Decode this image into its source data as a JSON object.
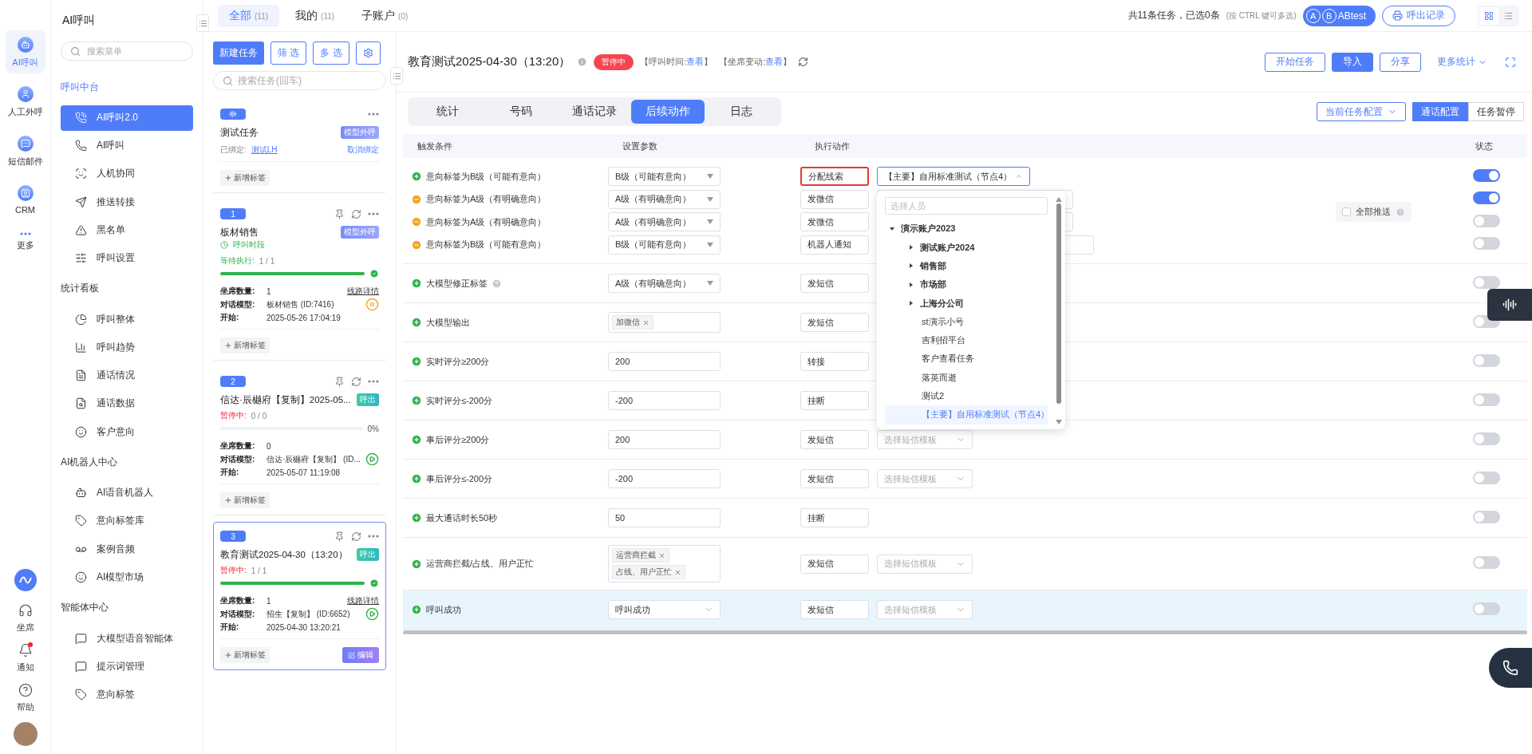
{
  "rail": {
    "items": [
      {
        "label": "AI呼叫",
        "kind": "bot",
        "selected": true
      },
      {
        "label": "人工外呼",
        "kind": "person",
        "selected": false
      },
      {
        "label": "短信邮件",
        "kind": "message",
        "selected": false
      },
      {
        "label": "CRM",
        "kind": "crm",
        "selected": false
      },
      {
        "label": "更多",
        "kind": "more",
        "selected": false
      }
    ],
    "bottom": [
      {
        "label": "坐席",
        "kind": "headset",
        "alert": false
      },
      {
        "label": "通知",
        "kind": "bell",
        "alert": true
      },
      {
        "label": "帮助",
        "kind": "help",
        "alert": false
      }
    ]
  },
  "menu": {
    "title": "AI呼叫",
    "search_placeholder": "搜索菜单",
    "sections": [
      {
        "title": "呼叫中台",
        "selected": true,
        "items": [
          {
            "label": "AI呼叫2.0",
            "kind": "phone-call",
            "selected": true
          },
          {
            "label": "AI呼叫",
            "kind": "phone",
            "selected": false
          },
          {
            "label": "人机协同",
            "kind": "scan",
            "selected": false
          },
          {
            "label": "推送转接",
            "kind": "send",
            "selected": false
          },
          {
            "label": "黑名单",
            "kind": "alert",
            "selected": false
          },
          {
            "label": "呼叫设置",
            "kind": "sliders",
            "selected": false
          }
        ]
      },
      {
        "title": "统计看板",
        "selected": false,
        "items": [
          {
            "label": "呼叫整体",
            "kind": "pie",
            "selected": false
          },
          {
            "label": "呼叫趋势",
            "kind": "bars",
            "selected": false
          },
          {
            "label": "通话情况",
            "kind": "doc",
            "selected": false
          },
          {
            "label": "通话数据",
            "kind": "doc-search",
            "selected": false
          },
          {
            "label": "客户意向",
            "kind": "smile",
            "selected": false
          }
        ]
      },
      {
        "title": "AI机器人中心",
        "selected": false,
        "items": [
          {
            "label": "AI语音机器人",
            "kind": "bot",
            "selected": false
          },
          {
            "label": "意向标签库",
            "kind": "tag",
            "selected": false
          },
          {
            "label": "案例音频",
            "kind": "voicemail",
            "selected": false
          },
          {
            "label": "AI模型市场",
            "kind": "smile",
            "selected": false
          }
        ]
      },
      {
        "title": "智能体中心",
        "selected": false,
        "items": [
          {
            "label": "大模型语音智能体",
            "kind": "chat",
            "selected": false
          },
          {
            "label": "提示词管理",
            "kind": "chat",
            "selected": false
          },
          {
            "label": "意向标签",
            "kind": "tag",
            "selected": false
          }
        ]
      }
    ]
  },
  "top": {
    "tabs": [
      {
        "label": "全部",
        "count": "(11)",
        "selected": true
      },
      {
        "label": "我的",
        "count": "(11)",
        "selected": false
      },
      {
        "label": "子账户",
        "count": "(0)",
        "selected": false
      }
    ],
    "summary": "共11条任务，已选0条",
    "hint": "(按 CTRL 键可多选)",
    "abtest": {
      "letters": [
        "A",
        "B"
      ],
      "label": "ABtest"
    },
    "records": "呼出记录",
    "views": [
      {
        "kind": "grid",
        "selected": true
      },
      {
        "kind": "list",
        "selected": false
      }
    ]
  },
  "task_list": {
    "new": "新建任务",
    "filter": "筛 选",
    "multi": "多 选",
    "search_placeholder": "搜索任务(回车)",
    "cards": [
      {
        "kind": "bound",
        "title": "测试任务",
        "tag": {
          "label": "模型外呼",
          "kind": "model"
        },
        "bound_label": "已绑定:",
        "bound_link": "测试LH",
        "unbind": "取消绑定",
        "add_tag": "新增标签",
        "selected": false
      },
      {
        "kind": "task",
        "number": "1",
        "title": "板材销售",
        "tag": {
          "label": "模型外呼",
          "kind": "model"
        },
        "schedule": "呼叫时段",
        "status": {
          "label": "等待执行:",
          "value": "1 / 1",
          "kind": "waiting"
        },
        "level": 1,
        "done": true,
        "seats_label": "坐席数量:",
        "seats": "1",
        "line_link": "线路详情",
        "model_label": "对话模型:",
        "model": "板材销售 (ID:7416)",
        "control": {
          "kind": "pause"
        },
        "start_label": "开始:",
        "start": "2025-05-26 17:04:19",
        "add_tag": "新增标签",
        "selected": false
      },
      {
        "kind": "task",
        "number": "2",
        "title": "信达·辰樾府【复制】2025-05...",
        "tag": {
          "label": "呼出",
          "kind": "call"
        },
        "status": {
          "label": "暂停中:",
          "value": "0 / 0",
          "kind": "paused"
        },
        "level": 0,
        "done": false,
        "percent": "0%",
        "seats_label": "坐席数量:",
        "seats": "0",
        "model_label": "对话模型:",
        "model": "信达·辰樾府【复制】 (ID...",
        "control": {
          "kind": "play"
        },
        "start_label": "开始:",
        "start": "2025-05-07 11:19:08",
        "add_tag": "新增标签",
        "selected": false
      },
      {
        "kind": "task",
        "number": "3",
        "title": "教育测试2025-04-30（13:20）",
        "tag": {
          "label": "呼出",
          "kind": "call"
        },
        "status": {
          "label": "暂停中:",
          "value": "1 / 1",
          "kind": "paused"
        },
        "level": 1,
        "done": true,
        "seats_label": "坐席数量:",
        "seats": "1",
        "line_link": "线路详情",
        "model_label": "对话模型:",
        "model": "招生【复制】 (ID:6652)",
        "control": {
          "kind": "play"
        },
        "start_label": "开始:",
        "start": "2025-04-30 13:20:21",
        "add_tag": "新增标签",
        "edit": "编辑",
        "selected": true
      }
    ]
  },
  "task": {
    "title": "教育测试2025-04-30（13:20）",
    "status": {
      "label": "暂停中",
      "kind": "paused"
    },
    "meta": [
      {
        "prefix": "【呼叫时间:",
        "link": "查看",
        "suffix": "】"
      },
      {
        "prefix": "【坐席变动:",
        "link": "查看",
        "suffix": "】"
      }
    ],
    "actions": [
      {
        "label": "开始任务",
        "primary": false
      },
      {
        "label": "导入",
        "primary": true
      },
      {
        "label": "分享",
        "primary": false
      }
    ],
    "more_stats": "更多统计",
    "tabs": [
      {
        "label": "统计",
        "selected": false
      },
      {
        "label": "号码",
        "selected": false
      },
      {
        "label": "通话记录",
        "selected": false
      },
      {
        "label": "后续动作",
        "selected": true
      },
      {
        "label": "日志",
        "selected": false
      }
    ],
    "config_select": "当前任务配置",
    "config_tabs": [
      {
        "label": "通话配置",
        "selected": true
      },
      {
        "label": "任务暂停",
        "selected": false
      }
    ]
  },
  "table": {
    "columns": [
      "触发条件",
      "设置参数",
      "执行动作",
      "状态"
    ],
    "groups": [
      {
        "selected": false,
        "push_all": {
          "label": "全部推送",
          "checked": false
        },
        "rows": [
          {
            "kind": "add",
            "condition": "意向标签为B级（可能有意向）",
            "help": false,
            "param": {
              "kind": "select",
              "value": "B级（可能有意向）"
            },
            "action": {
              "value": "分配线索",
              "highlighted": true
            },
            "target": {
              "kind": "assign",
              "value": "【主要】自用标准测试（节点4）",
              "open": true,
              "dropdown": {
                "placeholder": "选择人员",
                "tree": [
                  {
                    "label": "演示账户2023",
                    "kind": "branch",
                    "expanded": true,
                    "selected": false,
                    "children": [
                      {
                        "label": "测试账户2024",
                        "kind": "branch",
                        "expanded": false,
                        "selected": false
                      },
                      {
                        "label": "销售部",
                        "kind": "branch",
                        "expanded": false,
                        "selected": false
                      },
                      {
                        "label": "市场部",
                        "kind": "branch",
                        "expanded": false,
                        "selected": false
                      },
                      {
                        "label": "上海分公司",
                        "kind": "branch",
                        "expanded": false,
                        "selected": false
                      },
                      {
                        "label": "st演示小号",
                        "kind": "leaf",
                        "selected": false
                      },
                      {
                        "label": "吉利招平台",
                        "kind": "leaf",
                        "selected": false
                      },
                      {
                        "label": "客户查看任务",
                        "kind": "leaf",
                        "selected": false
                      },
                      {
                        "label": "落英而逝",
                        "kind": "leaf",
                        "selected": false
                      },
                      {
                        "label": "测试2",
                        "kind": "leaf",
                        "selected": false
                      },
                      {
                        "label": "【主要】自用标准测试（节点4）",
                        "kind": "leaf",
                        "selected": true
                      }
                    ]
                  }
                ]
              }
            },
            "on": true
          },
          {
            "kind": "remove",
            "condition": "意向标签为A级（有明确意向）",
            "help": false,
            "param": {
              "kind": "select",
              "value": "A级（有明确意向）"
            },
            "action": {
              "value": "发微信",
              "highlighted": false
            },
            "target": {
              "kind": "blank"
            },
            "on": true
          },
          {
            "kind": "remove",
            "condition": "意向标签为A级（有明确意向）",
            "help": false,
            "param": {
              "kind": "select",
              "value": "A级（有明确意向）"
            },
            "action": {
              "value": "发微信",
              "highlighted": false
            },
            "target": {
              "kind": "blank"
            },
            "on": false
          },
          {
            "kind": "remove",
            "condition": "意向标签为B级（可能有意向）",
            "help": false,
            "param": {
              "kind": "select",
              "value": "B级（可能有意向）"
            },
            "action": {
              "value": "机器人通知",
              "highlighted": false
            },
            "target": {
              "kind": "wide"
            },
            "on": false
          }
        ]
      },
      {
        "selected": false,
        "rows": [
          {
            "kind": "add",
            "condition": "大模型修正标签",
            "help": true,
            "param": {
              "kind": "select",
              "value": "A级（有明确意向）"
            },
            "action": {
              "value": "发短信",
              "highlighted": false
            },
            "on": false
          }
        ]
      },
      {
        "selected": false,
        "rows": [
          {
            "kind": "add",
            "condition": "大模型输出",
            "help": false,
            "param": {
              "kind": "tags",
              "tags": [
                "加微信"
              ]
            },
            "action": {
              "value": "发短信",
              "highlighted": false
            },
            "on": false
          }
        ]
      },
      {
        "selected": false,
        "rows": [
          {
            "kind": "add",
            "condition": "实时评分≥200分",
            "help": false,
            "param": {
              "kind": "input",
              "value": "200"
            },
            "action": {
              "value": "转接",
              "highlighted": false
            },
            "on": false
          }
        ]
      },
      {
        "selected": false,
        "rows": [
          {
            "kind": "add",
            "condition": "实时评分≤-200分",
            "help": false,
            "param": {
              "kind": "input",
              "value": "-200"
            },
            "action": {
              "value": "挂断",
              "highlighted": false
            },
            "on": false
          }
        ]
      },
      {
        "selected": false,
        "rows": [
          {
            "kind": "add",
            "condition": "事后评分≥200分",
            "help": false,
            "param": {
              "kind": "input",
              "value": "200"
            },
            "action": {
              "value": "发短信",
              "highlighted": false
            },
            "target": {
              "kind": "template",
              "placeholder": "选择短信模板"
            },
            "on": false
          }
        ]
      },
      {
        "selected": false,
        "rows": [
          {
            "kind": "add",
            "condition": "事后评分≤-200分",
            "help": false,
            "param": {
              "kind": "input",
              "value": "-200"
            },
            "action": {
              "value": "发短信",
              "highlighted": false
            },
            "target": {
              "kind": "template",
              "placeholder": "选择短信模板"
            },
            "on": false
          }
        ]
      },
      {
        "selected": false,
        "rows": [
          {
            "kind": "add",
            "condition": "最大通话时长50秒",
            "help": false,
            "param": {
              "kind": "input",
              "value": "50"
            },
            "action": {
              "value": "挂断",
              "highlighted": false
            },
            "on": false
          }
        ]
      },
      {
        "selected": false,
        "rows": [
          {
            "kind": "add",
            "condition": "运营商拦截/占线、用户正忙",
            "help": false,
            "param": {
              "kind": "tags",
              "tags": [
                "运营商拦截",
                "占线、用户正忙"
              ]
            },
            "action": {
              "value": "发短信",
              "highlighted": false
            },
            "target": {
              "kind": "template",
              "placeholder": "选择短信模板"
            },
            "on": false
          }
        ]
      },
      {
        "selected": true,
        "rows": [
          {
            "kind": "add",
            "condition": "呼叫成功",
            "help": false,
            "param": {
              "kind": "dropdown",
              "value": "呼叫成功"
            },
            "action": {
              "value": "发短信",
              "highlighted": false
            },
            "target": {
              "kind": "template",
              "placeholder": "选择短信模板"
            },
            "on": false
          }
        ]
      }
    ]
  }
}
